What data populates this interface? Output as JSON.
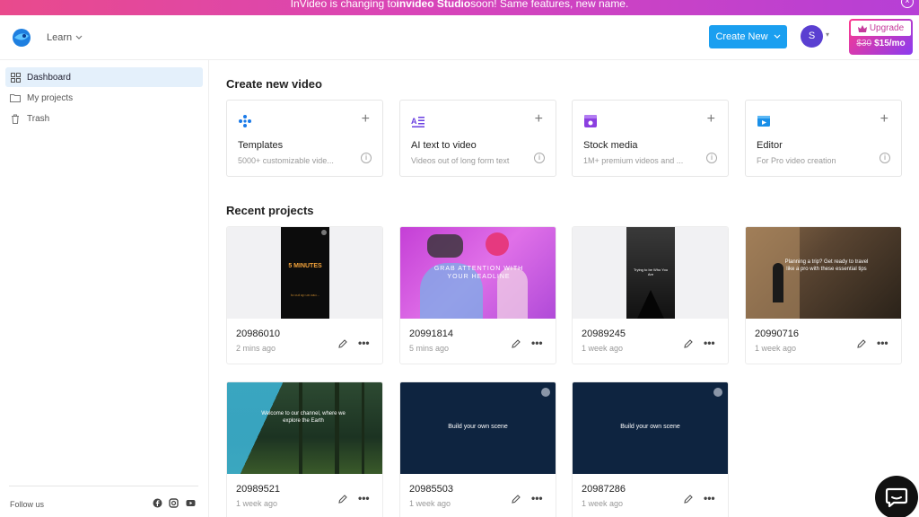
{
  "banner": {
    "text_prefix": "InVideo is changing to ",
    "text_bold": "invideo Studio",
    "text_suffix": " soon! Same features, new name.",
    "close_glyph": "×"
  },
  "header": {
    "learn_label": "Learn",
    "create_new_label": "Create New",
    "avatar_initial": "S",
    "upgrade_label": "Upgrade",
    "upgrade_old_price": "$30",
    "upgrade_new_price": "$15/mo"
  },
  "sidebar": {
    "items": [
      {
        "label": "Dashboard",
        "icon": "grid-icon"
      },
      {
        "label": "My projects",
        "icon": "folder-icon"
      },
      {
        "label": "Trash",
        "icon": "trash-icon"
      }
    ],
    "follow_label": "Follow us",
    "social": [
      "facebook-icon",
      "instagram-icon",
      "youtube-icon"
    ]
  },
  "create_section": {
    "title": "Create new video",
    "cards": [
      {
        "title": "Templates",
        "desc": "5000+ customizable vide...",
        "icon": "templates-icon"
      },
      {
        "title": "AI text to video",
        "desc": "Videos out of long form text",
        "icon": "ai-text-icon"
      },
      {
        "title": "Stock media",
        "desc": "1M+ premium videos and ...",
        "icon": "stock-media-icon"
      },
      {
        "title": "Editor",
        "desc": "For Pro video creation",
        "icon": "editor-icon"
      }
    ]
  },
  "recent_section": {
    "title": "Recent projects",
    "projects": [
      {
        "name": "20986010",
        "time": "2 mins ago",
        "thumb_text": "5 MINUTES",
        "thumb_sub": "to cut up un cao..."
      },
      {
        "name": "20991814",
        "time": "5 mins ago",
        "thumb_text": "GRAB ATTENTION WITH YOUR HEADLINE"
      },
      {
        "name": "20989245",
        "time": "1 week ago",
        "thumb_text": "Trying to be Who You Are"
      },
      {
        "name": "20990716",
        "time": "1 week ago",
        "thumb_text": "Planning a trip? Get ready to travel like a pro with these essential tips"
      },
      {
        "name": "20989521",
        "time": "1 week ago",
        "thumb_text": "Welcome to our channel, where we explore the Earth"
      },
      {
        "name": "20985503",
        "time": "1 week ago",
        "thumb_text": "Build your own scene"
      },
      {
        "name": "20987286",
        "time": "1 week ago",
        "thumb_text": "Build your own scene"
      }
    ]
  },
  "more_glyph": "•••"
}
